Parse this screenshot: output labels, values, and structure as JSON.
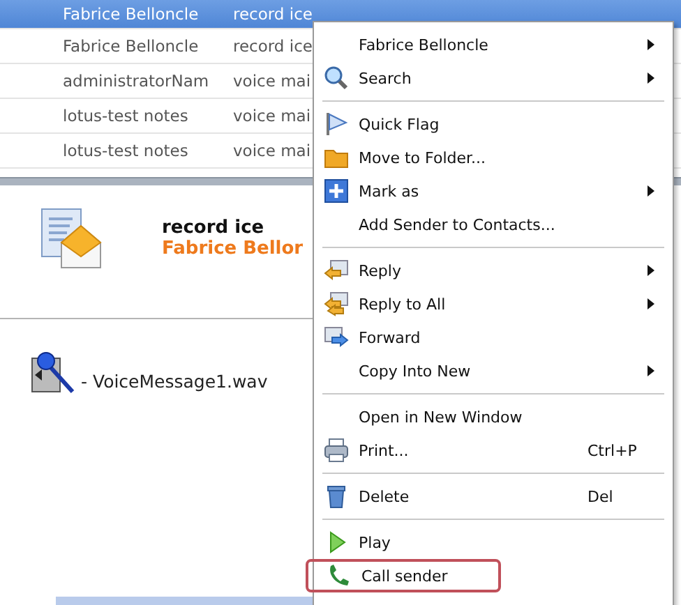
{
  "message_list": {
    "rows": [
      {
        "from": "Fabrice Belloncle",
        "subject": "record ice",
        "selected": true
      },
      {
        "from": "Fabrice Belloncle",
        "subject": "record ice",
        "selected": false
      },
      {
        "from": "administratorNam",
        "subject": "voice mai",
        "selected": false
      },
      {
        "from": "lotus-test notes",
        "subject": "voice mai",
        "selected": false
      },
      {
        "from": "lotus-test notes",
        "subject": "voice mai",
        "selected": false
      }
    ]
  },
  "preview": {
    "subject": "record ice",
    "sender": "Fabrice Bellor",
    "attachment": "- VoiceMessage1.wav"
  },
  "context_menu": {
    "groups": [
      [
        {
          "label": "Fabrice Belloncle",
          "submenu": true,
          "highlighted": false
        },
        {
          "label": "Search",
          "submenu": true,
          "highlighted": false
        }
      ],
      [
        {
          "label": "Quick Flag",
          "submenu": false,
          "highlighted": false
        },
        {
          "label": "Move to Folder...",
          "submenu": false,
          "highlighted": false
        },
        {
          "label": "Mark as",
          "submenu": true,
          "highlighted": false
        },
        {
          "label": "Add Sender to Contacts...",
          "submenu": false,
          "highlighted": false
        }
      ],
      [
        {
          "label": "Reply",
          "submenu": true,
          "highlighted": false
        },
        {
          "label": "Reply to All",
          "submenu": true,
          "highlighted": false
        },
        {
          "label": "Forward",
          "submenu": false,
          "highlighted": false
        },
        {
          "label": "Copy Into New",
          "submenu": true,
          "highlighted": false
        }
      ],
      [
        {
          "label": "Open in New Window",
          "submenu": false,
          "highlighted": false
        },
        {
          "label": "Print...",
          "shortcut": "Ctrl+P",
          "submenu": false,
          "highlighted": false
        }
      ],
      [
        {
          "label": "Delete",
          "shortcut": "Del",
          "submenu": false,
          "highlighted": false
        }
      ],
      [
        {
          "label": "Play",
          "submenu": false,
          "highlighted": false
        },
        {
          "label": "Call sender",
          "submenu": false,
          "highlighted": true
        }
      ]
    ]
  }
}
